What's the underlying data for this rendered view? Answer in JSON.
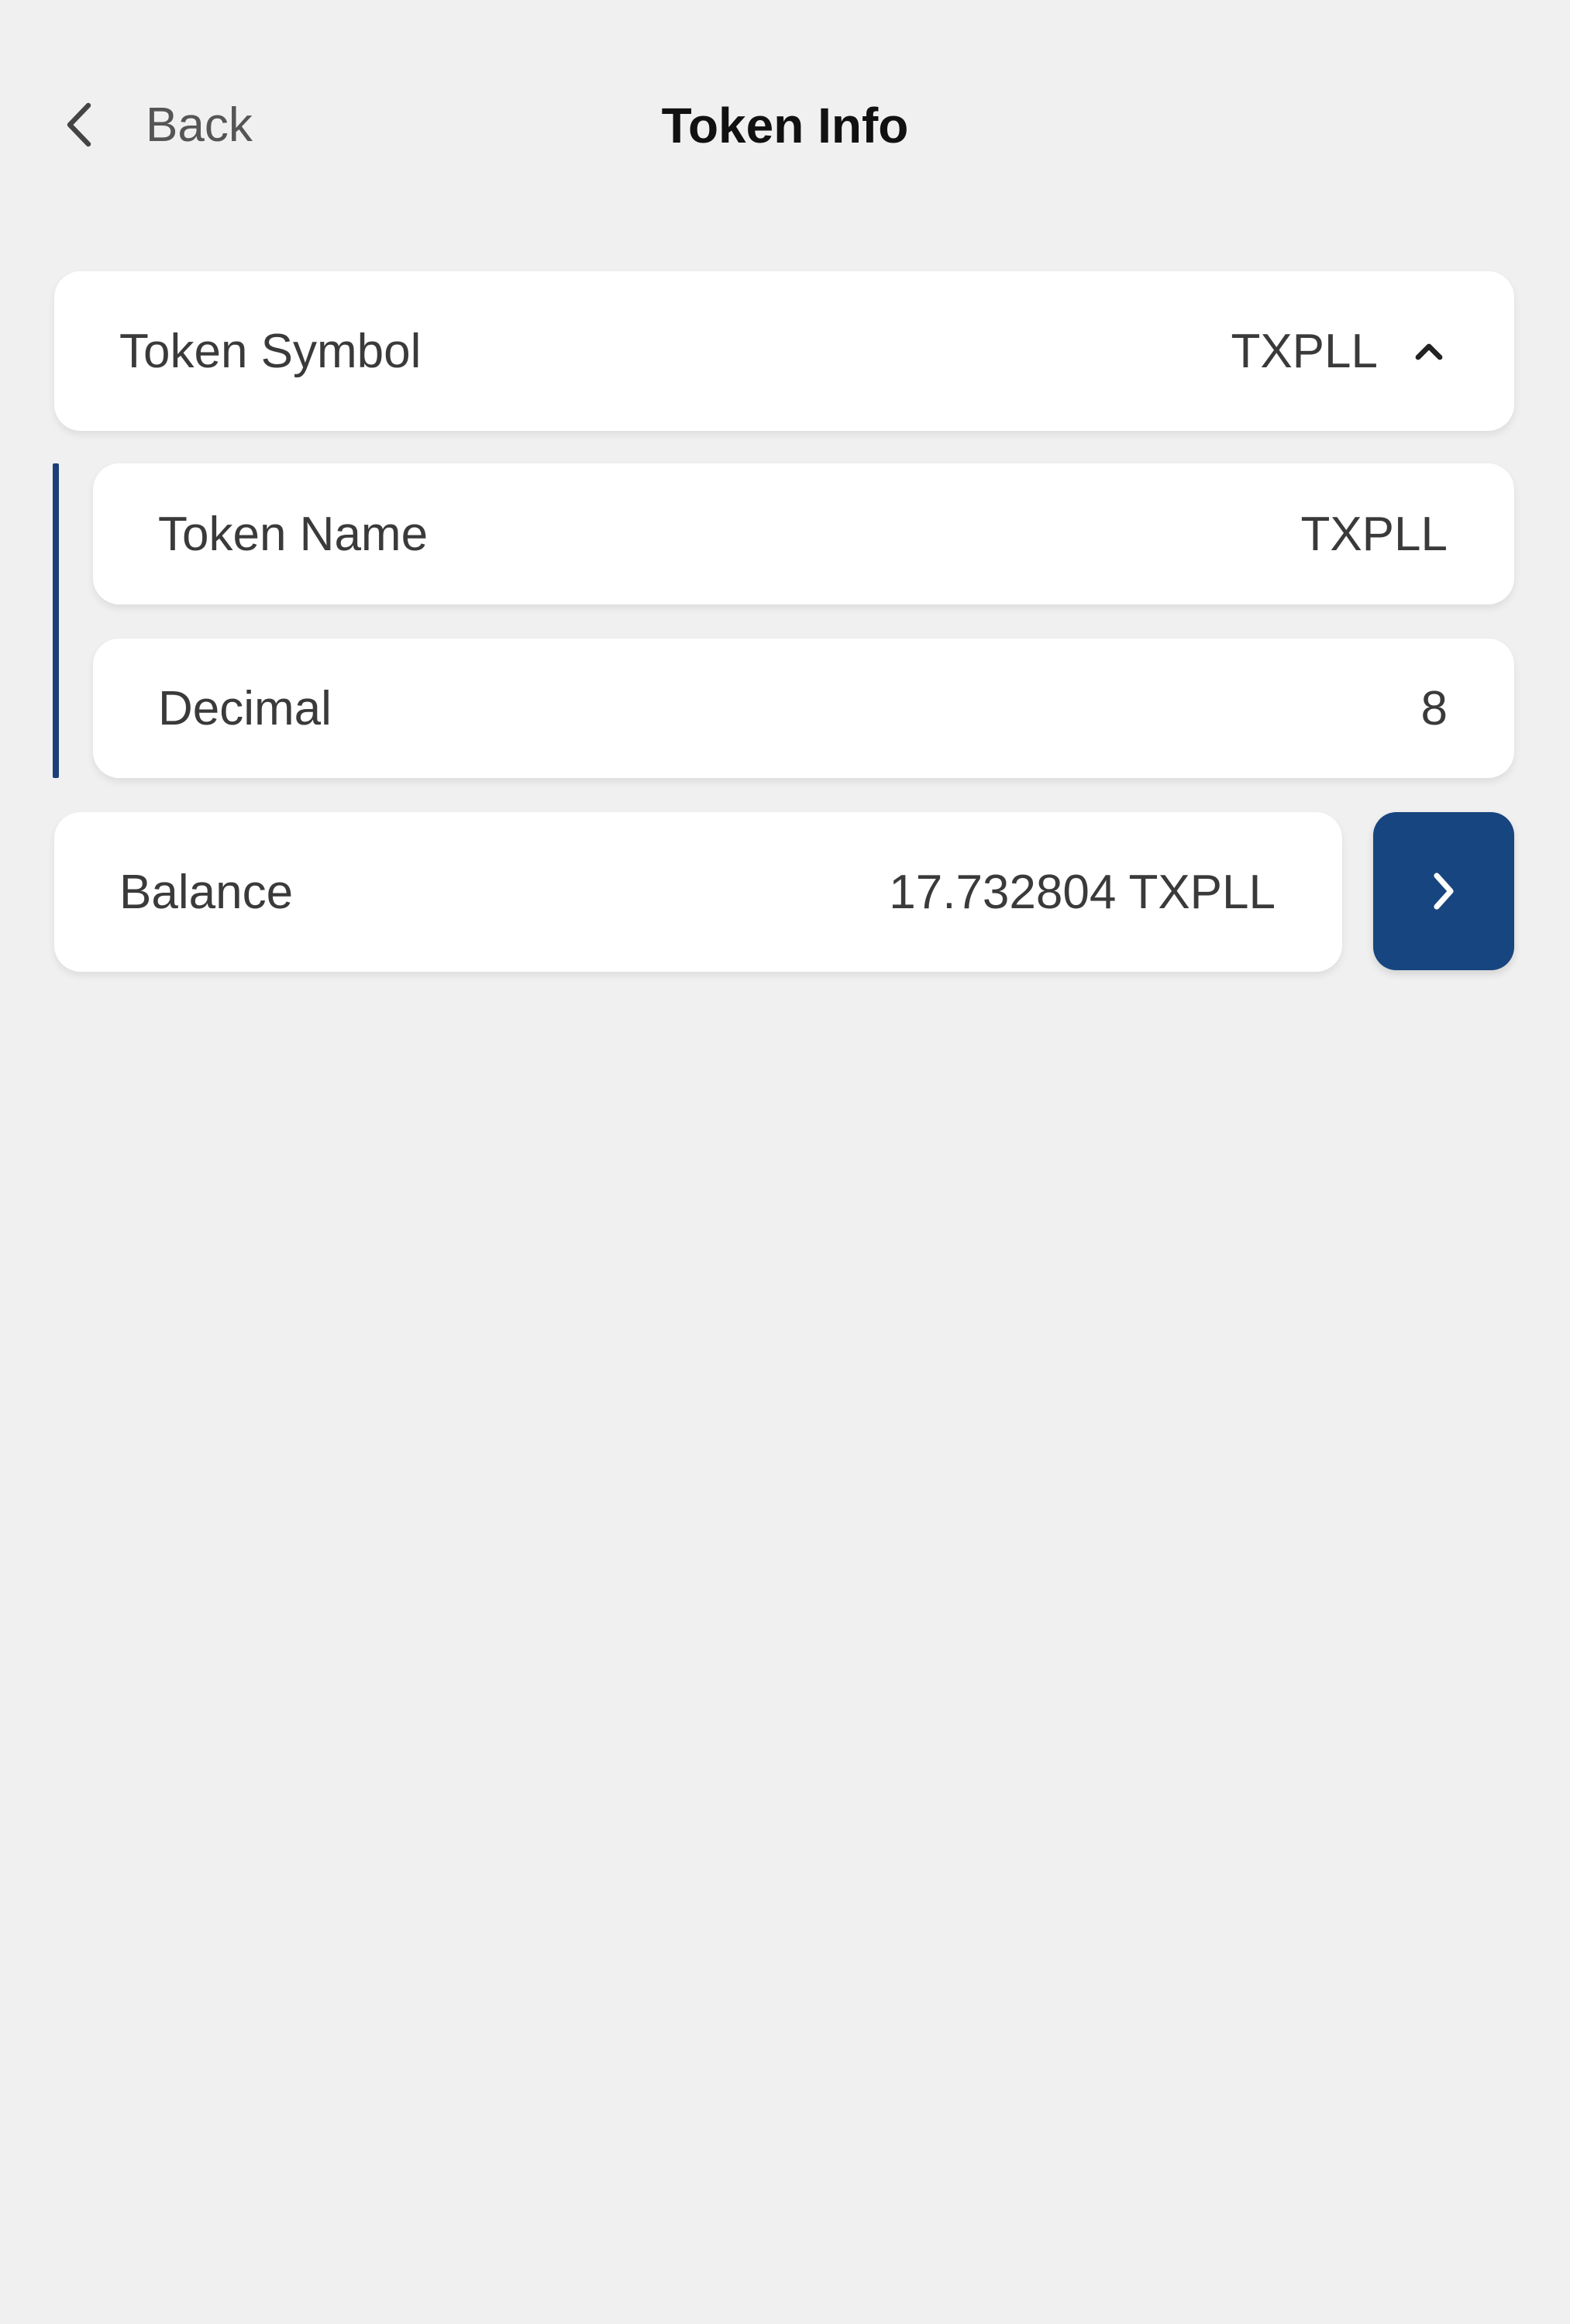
{
  "header": {
    "back_label": "Back",
    "title": "Token Info"
  },
  "token_symbol": {
    "label": "Token Symbol",
    "value": "TXPLL",
    "expanded": true
  },
  "token_name": {
    "label": "Token Name",
    "value": "TXPLL"
  },
  "decimal": {
    "label": "Decimal",
    "value": "8"
  },
  "balance": {
    "label": "Balance",
    "value": "17.732804 TXPLL"
  },
  "icons": {
    "back": "chevron-left-icon",
    "collapse": "caret-up-icon",
    "go": "chevron-right-icon"
  },
  "colors": {
    "background": "#f0f0f0",
    "card": "#ffffff",
    "accent": "#17457f"
  }
}
